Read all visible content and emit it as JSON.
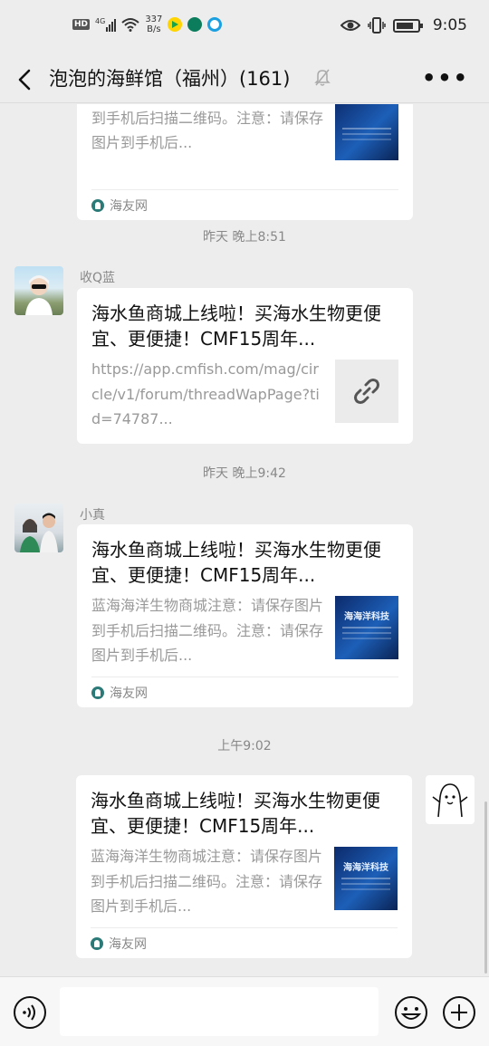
{
  "status_bar": {
    "network_badge": "HD",
    "signal_label": "4G",
    "speed_value": "337",
    "speed_unit": "B/s",
    "time": "9:05"
  },
  "header": {
    "back_icon": "chevron-left-icon",
    "title": "泡泡的海鲜馆（福州）(161)",
    "mute_icon": "bell-muted-icon",
    "more_label": "•••"
  },
  "messages": [
    {
      "type": "card-partial",
      "desc": "蓝海海洋生物商城注意：请保存图片到手机后扫描二维码。注意：请保存图片到手机后...",
      "source": "海友网"
    },
    {
      "type": "timestamp",
      "text": "昨天 晚上8:51"
    },
    {
      "type": "incoming",
      "sender": "收Q蓝",
      "title": "海水鱼商城上线啦！买海水生物更便宜、更便捷！CMF15周年...",
      "desc": "https://app.cmfish.com/mag/circle/v1/forum/threadWapPage?tid=74787...",
      "thumb_icon": "link-icon"
    },
    {
      "type": "timestamp",
      "text": "昨天 晚上9:42"
    },
    {
      "type": "incoming",
      "sender": "小真",
      "title": "海水鱼商城上线啦！买海水生物更便宜、更便捷！CMF15周年...",
      "desc": "蓝海海洋生物商城注意：请保存图片到手机后扫描二维码。注意：请保存图片到手机后...",
      "thumb_text": "海海洋科技",
      "source": "海友网"
    },
    {
      "type": "timestamp",
      "text": "上午9:02"
    },
    {
      "type": "outgoing",
      "title": "海水鱼商城上线啦！买海水生物更便宜、更便捷！CMF15周年...",
      "desc": "蓝海海洋生物商城注意：请保存图片到手机后扫描二维码。注意：请保存图片到手机后...",
      "thumb_text": "海海洋科技",
      "source": "海友网"
    }
  ],
  "input_bar": {
    "voice_icon": "voice-icon",
    "emoji_icon": "emoji-icon",
    "plus_icon": "plus-icon"
  },
  "colors": {
    "background": "#ededed",
    "card": "#ffffff",
    "muted_text": "#999999",
    "source_icon": "#2b7a78"
  }
}
